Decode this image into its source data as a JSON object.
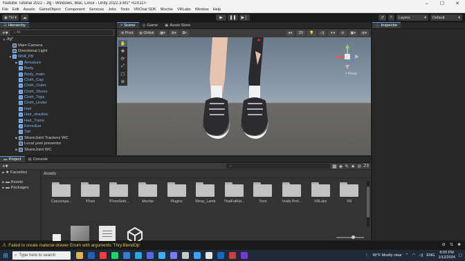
{
  "window": {
    "title": "Youtube Tutorial 2022 - Jfg - Windows, Mac, Linux - Unity 2022.3.6f1* <DX11>",
    "controls": [
      "–",
      "☐",
      "✕"
    ]
  },
  "menu": [
    "File",
    "Edit",
    "Assets",
    "GameObject",
    "Component",
    "Services",
    "Jobs",
    "Tools",
    "VRChat SDK",
    "Mochie",
    "VRLabs",
    "Window",
    "Help"
  ],
  "toolbar": {
    "account_label": "TH",
    "layers_label": "Layers",
    "layout_label": "Default"
  },
  "hierarchy": {
    "tab_label": "Hierarchy",
    "search_placeholder": "All",
    "scene_name": "Jfg*",
    "items": [
      {
        "label": "Main Camera",
        "depth": 1,
        "kind": "go",
        "arrow": ""
      },
      {
        "label": "Directional Light",
        "depth": 1,
        "kind": "go",
        "arrow": ""
      },
      {
        "label": "Wolf_P8",
        "depth": 1,
        "kind": "prefab",
        "arrow": "▼",
        "blue": true
      },
      {
        "label": "Armature",
        "depth": 2,
        "kind": "prefab",
        "arrow": "▶",
        "blue": true
      },
      {
        "label": "Body",
        "depth": 2,
        "kind": "prefab",
        "arrow": "",
        "blue": true
      },
      {
        "label": "Body_main",
        "depth": 2,
        "kind": "prefab",
        "arrow": "",
        "blue": true
      },
      {
        "label": "Cloth_Cap",
        "depth": 2,
        "kind": "prefab",
        "arrow": "",
        "blue": true
      },
      {
        "label": "Cloth_Outer",
        "depth": 2,
        "kind": "prefab",
        "arrow": "",
        "blue": true
      },
      {
        "label": "Cloth_Shoes",
        "depth": 2,
        "kind": "prefab",
        "arrow": "",
        "blue": true
      },
      {
        "label": "Cloth_Tops",
        "depth": 2,
        "kind": "prefab",
        "arrow": "",
        "blue": true
      },
      {
        "label": "Cloth_Under",
        "depth": 2,
        "kind": "prefab",
        "arrow": "",
        "blue": true
      },
      {
        "label": "Hair",
        "depth": 2,
        "kind": "prefab",
        "arrow": "",
        "blue": true
      },
      {
        "label": "Hair_shadow",
        "depth": 2,
        "kind": "prefab",
        "arrow": "",
        "blue": true
      },
      {
        "label": "Hair_Trans",
        "depth": 2,
        "kind": "prefab",
        "arrow": "",
        "blue": true
      },
      {
        "label": "KemoEar",
        "depth": 2,
        "kind": "prefab",
        "arrow": "",
        "blue": true
      },
      {
        "label": "Tail",
        "depth": 2,
        "kind": "prefab",
        "arrow": "",
        "blue": true
      },
      {
        "label": "ShareJoint Trackers WC",
        "depth": 2,
        "kind": "go",
        "arrow": "▶"
      },
      {
        "label": "Local yeet preventor",
        "depth": 2,
        "kind": "go",
        "arrow": ""
      },
      {
        "label": "ShareJoint WC",
        "depth": 2,
        "kind": "go",
        "arrow": "▶"
      }
    ]
  },
  "scene_view": {
    "tabs": [
      "Scene",
      "Game",
      "Asset Store"
    ],
    "pivot_label": "Pivot",
    "global_label": "Global",
    "mode_2d": "2D",
    "persp_label": "< Persp"
  },
  "inspector": {
    "tab_label": "Inspector"
  },
  "project": {
    "tabs": [
      "Project",
      "Console"
    ],
    "favorites_label": "Favorites",
    "tree": [
      "Assets",
      "Packages"
    ],
    "breadcrumb": "Assets",
    "hidden_count": "23",
    "folders": [
      "Cancerspa...",
      "!lToon",
      "!lToonSetti...",
      "Mochie",
      "Plugins",
      "Shray_Lamb",
      "ThatFatKid...",
      "Toon",
      "Voids Pref...",
      "VRLabs",
      "XR"
    ]
  },
  "status": {
    "message": "Failed to create material drawer Enum with arguments 'Thry.BlendOp'"
  },
  "taskbar": {
    "search_placeholder": "Type here to search",
    "weather": "49°F  Mostly clear",
    "language": "ENG",
    "time": "8:00 PM",
    "date": "1/12/2024",
    "app_colors": [
      "#e0b34d",
      "#1f5fbf",
      "#ff3b3b",
      "#1ed760",
      "#3a7bd5",
      "#2aa6e6",
      "#5865f2",
      "#3ab0f0",
      "#7b7bff",
      "#c9c9c9",
      "#3fa3ff",
      "#e5e5e5",
      "#1767c1",
      "#d03b3b",
      "#7a35d6"
    ]
  }
}
